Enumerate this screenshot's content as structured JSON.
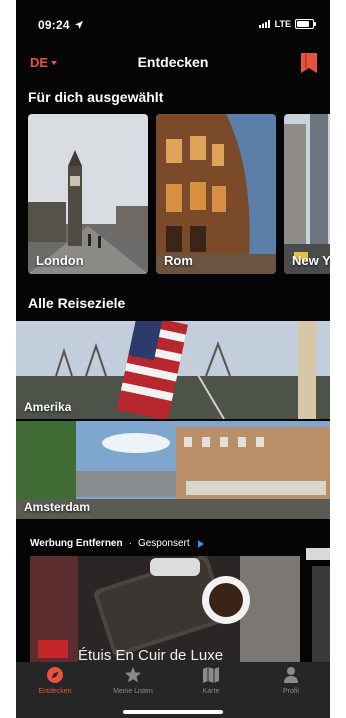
{
  "status_bar": {
    "time": "09:24",
    "network": "LTE"
  },
  "nav": {
    "language": "DE",
    "title": "Entdecken"
  },
  "featured": {
    "title": "Für dich ausgewählt",
    "cards": [
      {
        "label": "London"
      },
      {
        "label": "Rom"
      },
      {
        "label": "New York"
      }
    ]
  },
  "destinations": {
    "title": "Alle Reiseziele",
    "items": [
      {
        "label": "Amerika"
      },
      {
        "label": "Amsterdam"
      }
    ]
  },
  "ad": {
    "remove_label": "Werbung Entfernen",
    "separator": "·",
    "sponsored_label": "Gesponsert",
    "title": "Étuis En Cuir de Luxe"
  },
  "tabs": [
    {
      "label": "Entdecken",
      "icon": "compass-icon",
      "active": true
    },
    {
      "label": "Meine Listen",
      "icon": "star-icon",
      "active": false
    },
    {
      "label": "Karte",
      "icon": "map-icon",
      "active": false
    },
    {
      "label": "Profil",
      "icon": "person-icon",
      "active": false
    }
  ],
  "colors": {
    "accent": "#e8533d",
    "background": "#050505",
    "sponsored": "#2b8ef0"
  }
}
